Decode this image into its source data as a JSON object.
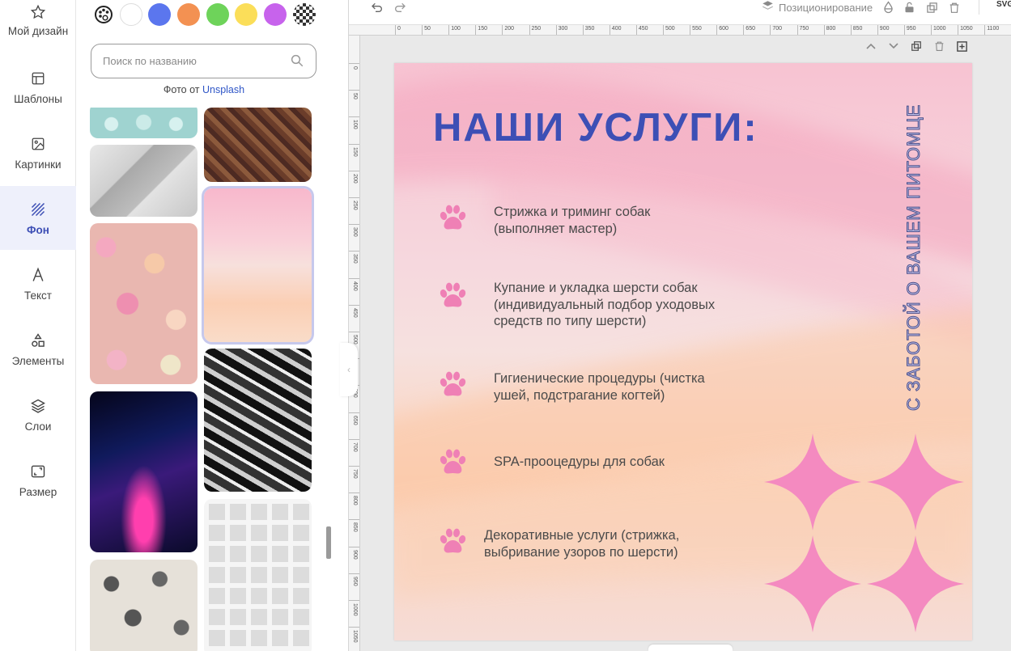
{
  "nav": {
    "items": [
      {
        "label": "Мой дизайн",
        "icon": "star-icon"
      },
      {
        "label": "Шаблоны",
        "icon": "template-icon"
      },
      {
        "label": "Картинки",
        "icon": "image-icon"
      },
      {
        "label": "Фон",
        "icon": "background-icon",
        "active": true
      },
      {
        "label": "Текст",
        "icon": "text-icon"
      },
      {
        "label": "Элементы",
        "icon": "shapes-icon"
      },
      {
        "label": "Слои",
        "icon": "layers-icon"
      },
      {
        "label": "Размер",
        "icon": "resize-icon"
      }
    ]
  },
  "panel": {
    "swatches": [
      {
        "name": "palette",
        "color": "#ffffff"
      },
      {
        "name": "white",
        "color": "#ffffff"
      },
      {
        "name": "blue",
        "color": "#5b76ee"
      },
      {
        "name": "orange",
        "color": "#f39152"
      },
      {
        "name": "green",
        "color": "#6ed35a"
      },
      {
        "name": "yellow",
        "color": "#fbde59"
      },
      {
        "name": "purple",
        "color": "#c763ec"
      },
      {
        "name": "transparent",
        "color": "checker"
      }
    ],
    "search_placeholder": "Поиск по названию",
    "credit_prefix": "Фото от",
    "credit_link": "Unsplash"
  },
  "toolbar": {
    "undo": "undo-icon",
    "redo": "redo-icon",
    "position_label": "Позиционирование",
    "export_label": "SVG"
  },
  "ruler": {
    "h_ticks": [
      "0",
      "50",
      "100",
      "150",
      "200",
      "250",
      "300",
      "350",
      "400",
      "450",
      "500",
      "550",
      "600",
      "650",
      "700",
      "750",
      "800",
      "850",
      "900",
      "950",
      "1000",
      "1050",
      "1100"
    ],
    "v_ticks": [
      "0",
      "50",
      "100",
      "150",
      "200",
      "250",
      "300",
      "350",
      "400",
      "450",
      "500",
      "550",
      "600",
      "650",
      "700",
      "750",
      "800",
      "850",
      "900",
      "950",
      "1000",
      "1050"
    ]
  },
  "design": {
    "headline": "НАШИ УСЛУГИ:",
    "vertical_text": "С ЗАБОТОЙ О ВАШЕМ ПИТОМЦЕ",
    "services": [
      {
        "text": "Стрижка и триминг собак\n(выполняет мастер)"
      },
      {
        "text": "Купание и укладка шерсти собак\n(индивидуальный подбор уходовых\nсредств по типу шерсти)"
      },
      {
        "text": "Гигиенические процедуры (чистка\nушей, подстрагание когтей)"
      },
      {
        "text": "SPA-прооцедуры для собак"
      },
      {
        "text": "Декоративные услуги (стрижка,\nвыбривание узоров по шерсти)"
      }
    ],
    "colors": {
      "headline": "#3d4fb5",
      "paw": "#ef80b5",
      "stars": "#f48ac0",
      "bg_pink": "#f7b5cb",
      "bg_peach": "#fcd3b4"
    }
  }
}
